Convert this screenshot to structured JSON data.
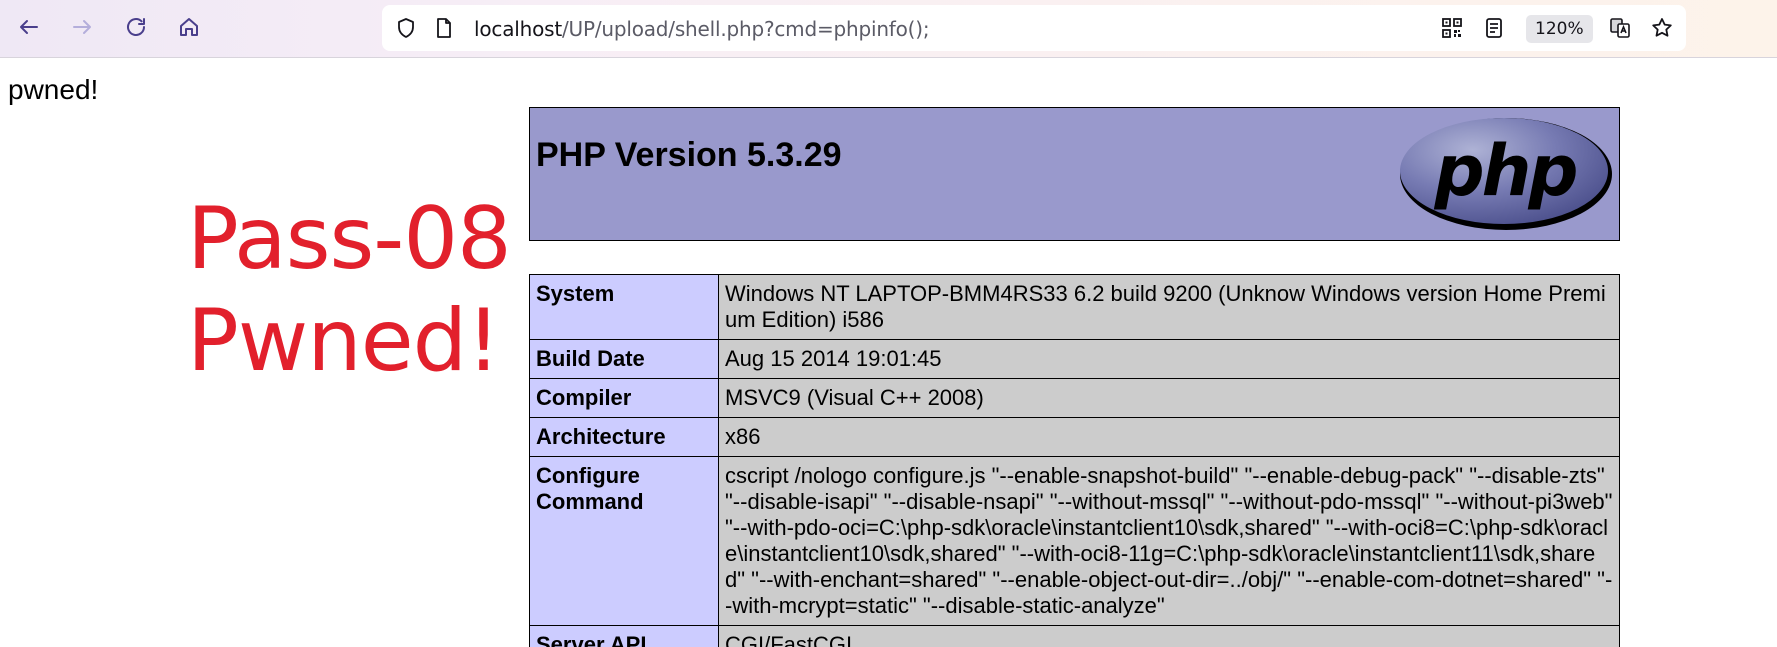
{
  "browser": {
    "url_host": "localhost",
    "url_path": "/UP/upload/shell.php?cmd=phpinfo();",
    "zoom": "120%",
    "icons": [
      "back-arrow-icon",
      "forward-arrow-icon",
      "reload-icon",
      "home-icon",
      "shield-icon",
      "page-icon",
      "qr-code-icon",
      "reader-view-icon",
      "translate-icon",
      "star-bookmark-icon"
    ]
  },
  "page": {
    "pwned_text": "pwned!",
    "pass_line1": "Pass-08",
    "pass_line2": "Pwned!",
    "pass_color": "#e2202c"
  },
  "phpinfo": {
    "title": "PHP Version 5.3.29",
    "logo_text": "php",
    "header_color": "#9999cc",
    "key_color": "#ccccff",
    "value_color": "#cccccc",
    "rows": [
      {
        "key": "System",
        "value": "Windows NT LAPTOP-BMM4RS33 6.2 build 9200 (Unknow Windows version Home Premium Edition) i586"
      },
      {
        "key": "Build Date",
        "value": "Aug 15 2014 19:01:45"
      },
      {
        "key": "Compiler",
        "value": "MSVC9 (Visual C++ 2008)"
      },
      {
        "key": "Architecture",
        "value": "x86"
      },
      {
        "key": "Configure Command",
        "value": "cscript /nologo configure.js \"--enable-snapshot-build\" \"--enable-debug-pack\" \"--disable-zts\" \"--disable-isapi\" \"--disable-nsapi\" \"--without-mssql\" \"--without-pdo-mssql\" \"--without-pi3web\" \"--with-pdo-oci=C:\\php-sdk\\oracle\\instantclient10\\sdk,shared\" \"--with-oci8=C:\\php-sdk\\oracle\\instantclient10\\sdk,shared\" \"--with-oci8-11g=C:\\php-sdk\\oracle\\instantclient11\\sdk,shared\" \"--with-enchant=shared\" \"--enable-object-out-dir=../obj/\" \"--enable-com-dotnet=shared\" \"--with-mcrypt=static\" \"--disable-static-analyze\""
      },
      {
        "key": "Server API",
        "value": "CGI/FastCGI"
      }
    ]
  }
}
